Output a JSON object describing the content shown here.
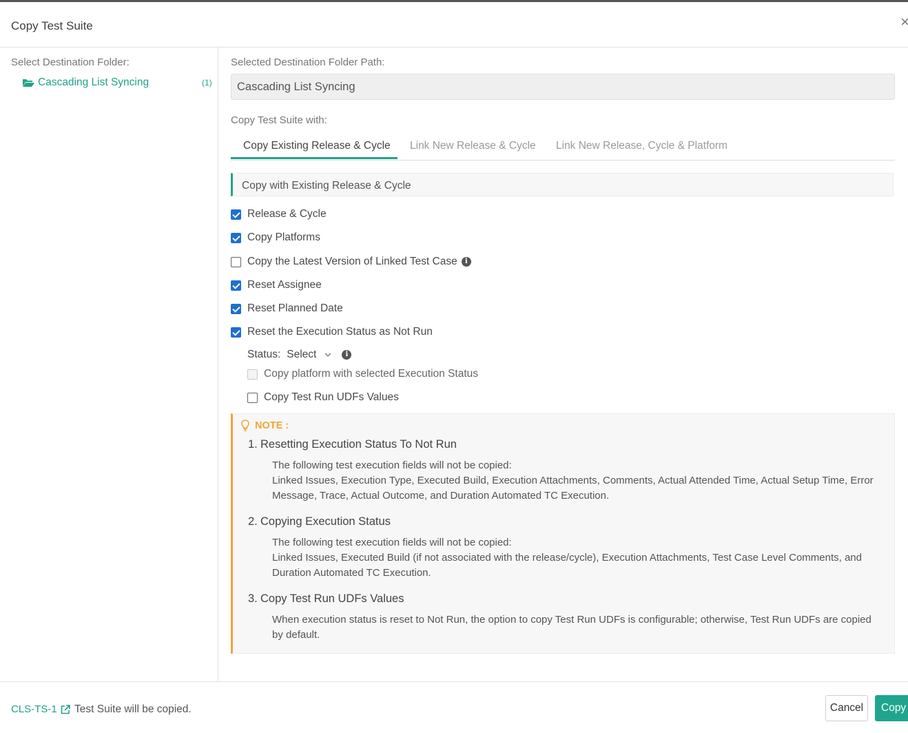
{
  "dialog": {
    "title": "Copy Test Suite",
    "close_symbol": "×"
  },
  "left": {
    "label": "Select Destination Folder:",
    "folder": {
      "name": "Cascading List Syncing",
      "count": "(1)"
    }
  },
  "right": {
    "path_label": "Selected Destination Folder Path:",
    "path_value": "Cascading List Syncing",
    "copy_with_label": "Copy Test Suite with:",
    "tabs": [
      {
        "label": "Copy Existing Release & Cycle",
        "active": true
      },
      {
        "label": "Link New Release & Cycle",
        "active": false
      },
      {
        "label": "Link New Release, Cycle & Platform",
        "active": false
      }
    ],
    "subheader": "Copy with Existing Release & Cycle",
    "options": [
      {
        "label": "Release & Cycle",
        "checked": true
      },
      {
        "label": "Copy Platforms",
        "checked": true
      },
      {
        "label": "Copy the Latest Version of Linked Test Case",
        "checked": false
      },
      {
        "label": "Reset Assignee",
        "checked": true
      },
      {
        "label": "Reset Planned Date",
        "checked": true
      },
      {
        "label": "Reset the Execution Status as Not Run",
        "checked": true
      }
    ],
    "status": {
      "label": "Status:",
      "value": "Select"
    },
    "sub_options": [
      {
        "label": "Copy platform with selected Execution Status",
        "checked": false,
        "disabled": true
      },
      {
        "label": "Copy Test Run UDFs Values",
        "checked": false,
        "disabled": false
      }
    ],
    "info_symbol": "i"
  },
  "note": {
    "title": "NOTE :",
    "items": [
      {
        "num": "1.",
        "heading": "Resetting Execution Status To Not Run",
        "line1": "The following test execution fields will not be copied:",
        "line2": "Linked Issues, Execution Type, Executed Build, Execution Attachments, Comments, Actual Attended Time, Actual Setup Time, Error Message, Trace, Actual Outcome, and Duration Automated TC Execution."
      },
      {
        "num": "2.",
        "heading": "Copying Execution Status",
        "line1": "The following test execution fields will not be copied:",
        "line2": "Linked Issues, Executed Build (if not associated with the release/cycle), Execution Attachments, Test Case Level Comments, and Duration Automated TC Execution."
      },
      {
        "num": "3.",
        "heading": "Copy Test Run UDFs Values",
        "line1": "When execution status is reset to Not Run, the option to copy Test Run UDFs is configurable; otherwise, Test Run UDFs are copied by default."
      }
    ]
  },
  "footer": {
    "link": "CLS-TS-1",
    "message": "Test Suite will be copied.",
    "cancel": "Cancel",
    "copy": "Copy"
  },
  "colors": {
    "accent": "#21a28a",
    "note": "#f4a23a",
    "checkbox": "#1e6fd0"
  }
}
